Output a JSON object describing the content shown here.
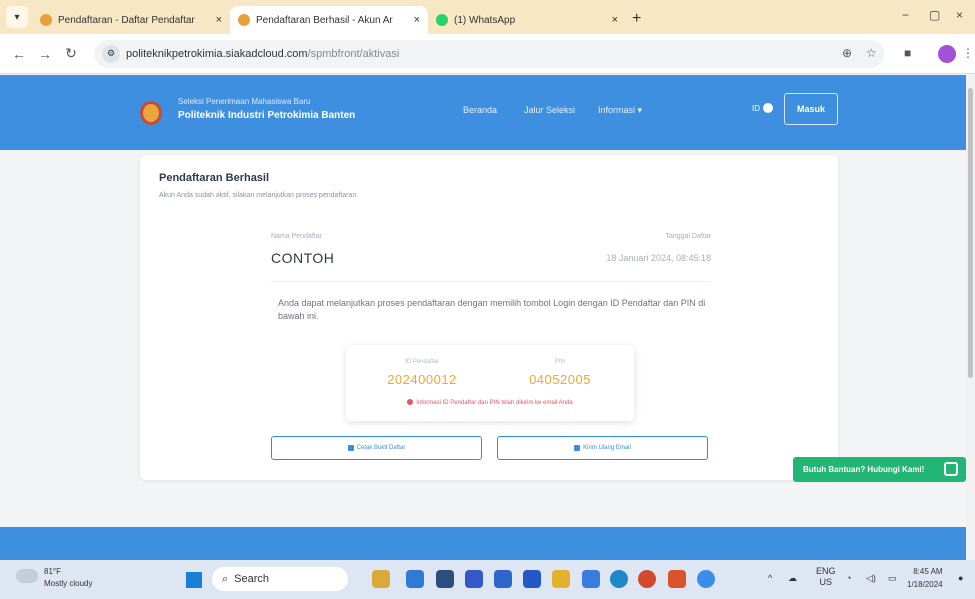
{
  "browser": {
    "tabs": [
      {
        "label": "Pendaftaran - Daftar Pendaftar",
        "close": "×",
        "active": false,
        "fav_color": "#e6a13a"
      },
      {
        "label": "Pendaftaran Berhasil - Akun Ar",
        "close": "×",
        "active": true,
        "fav_color": "#e6a13a"
      },
      {
        "label": "(1) WhatsApp",
        "close": "×",
        "active": false,
        "fav_color": "#25d366"
      }
    ],
    "new_tab": "+",
    "window_controls": [
      "−",
      "▢",
      "×"
    ],
    "url_host": "politeknikpetrokimia.siakadcloud.com",
    "url_path": "/spmbfront/aktivasi"
  },
  "site": {
    "brand_sub": "Seleksi Penerimaan Mahasiswa Baru",
    "brand_main": "Politeknik Industri Petrokimia Banten",
    "nav": [
      "Beranda",
      "Jalur Seleksi",
      "Informasi ▾"
    ],
    "lang": "ID",
    "login_label": "Masuk"
  },
  "card": {
    "title": "Pendaftaran Berhasil",
    "subtitle": "Akun Anda sudah aktif, silakan melanjutkan proses pendaftaran.",
    "nama_label": "Nama Pendaftar",
    "nama_value": "CONTOH",
    "tanggal_label": "Tanggal Daftar",
    "tanggal_value": "18 Januari 2024, 08:45:18",
    "info": "Anda dapat melanjutkan proses pendaftaran dengan memilih tombol Login dengan ID Pendaftar dan PIN di bawah ini.",
    "id_label": "ID Pendaftar",
    "id_value": "202400012",
    "pin_label": "PIN",
    "pin_value": "04052005",
    "notice": "Informasi ID Pendaftar dan PIN telah dikirim ke email Anda",
    "btn_cetak": "Cetak Bukti Daftar",
    "btn_email": "Kirim Ulang Email"
  },
  "help_label": "Butuh Bantuan? Hubungi Kami!",
  "taskbar": {
    "temp": "81°F",
    "weather": "Mostly cloudy",
    "search": "Search",
    "lang_top": "ENG",
    "lang_bottom": "US",
    "time": "8:45 AM",
    "date": "1/18/2024"
  }
}
